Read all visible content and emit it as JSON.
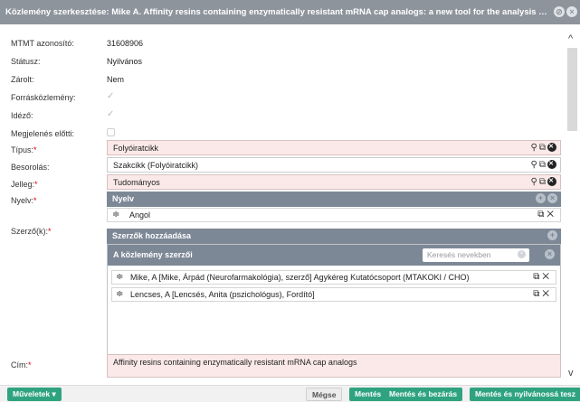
{
  "window": {
    "title": "Közlemény szerkesztése: Mike A. Affinity resins containing enzymatically resistant mRNA cap analogs: a new tool for the analysis of ca…"
  },
  "fields": {
    "mtmt_id": {
      "label": "MTMT azonosító:",
      "value": "31608906"
    },
    "status": {
      "label": "Státusz:",
      "value": "Nyilvános"
    },
    "locked": {
      "label": "Zárolt:",
      "value": "Nem"
    },
    "source_pub": {
      "label": "Forrásközlemény:"
    },
    "citing": {
      "label": "Idéző:"
    },
    "pre_publication": {
      "label": "Megjelenés előtti:"
    },
    "type": {
      "label": "Típus:",
      "value": "Folyóiratcikk"
    },
    "classification": {
      "label": "Besorolás:",
      "value": "Szakcikk (Folyóiratcikk)"
    },
    "character": {
      "label": "Jelleg:",
      "value": "Tudományos"
    },
    "language": {
      "label": "Nyelv:",
      "panel_title": "Nyelv",
      "items": [
        "Angol"
      ]
    },
    "authors": {
      "label": "Szerző(k):",
      "add_panel_title": "Szerzők hozzáadása",
      "list_title": "A közlemény szerzői",
      "search_placeholder": "Keresés nevekben",
      "items": [
        "Mike, A [Mike, Árpád (Neurofarmakológia), szerző] Agykéreg Kutatócsoport (MTAKOKI / CHO)",
        "Lencses, A [Lencsés, Anita (pszichológus), Fordító]"
      ]
    },
    "title_field": {
      "label": "Cím:",
      "value": "Affinity resins containing enzymatically resistant mRNA cap analogs"
    }
  },
  "footer": {
    "actions_label": "Műveletek",
    "cancel_label": "Mégse",
    "save_label": "Mentés",
    "save_close_label": "Mentés és bezárás",
    "save_publish_label": "Mentés és nyilvánossá tesz"
  },
  "colors": {
    "titlebar": "#8d949c",
    "panel_header": "#7d8896",
    "required_bg": "#fbe9e9",
    "required_star": "#d0021b",
    "button_green": "#2fa37f"
  }
}
